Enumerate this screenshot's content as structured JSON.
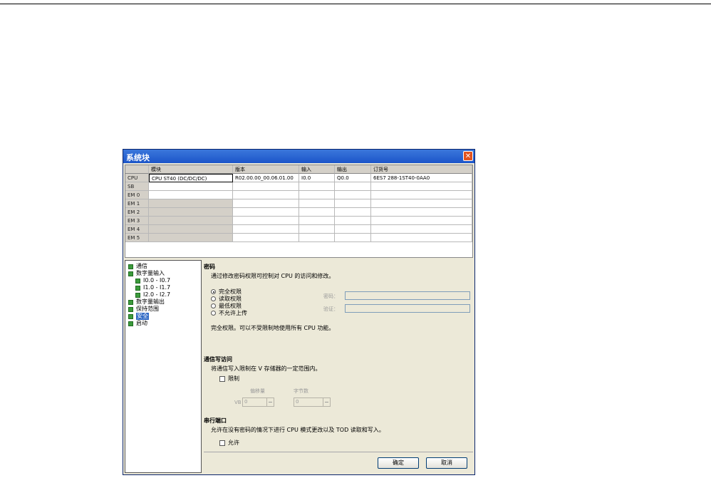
{
  "window": {
    "title": "系统块",
    "close_glyph": "✕"
  },
  "grid": {
    "headers": [
      "",
      "模块",
      "版本",
      "输入",
      "输出",
      "订货号"
    ],
    "rows": [
      {
        "label": "CPU",
        "module": "CPU ST40 (DC/DC/DC)",
        "version": "R02.00.00_00.06.01.00",
        "input": "I0.0",
        "output": "Q0.0",
        "order": "6ES7 288-1ST40-0AA0"
      },
      {
        "label": "SB",
        "module": "",
        "version": "",
        "input": "",
        "output": "",
        "order": ""
      },
      {
        "label": "EM 0",
        "module": "",
        "version": "",
        "input": "",
        "output": "",
        "order": ""
      },
      {
        "label": "EM 1",
        "module": "",
        "version": "",
        "input": "",
        "output": "",
        "order": ""
      },
      {
        "label": "EM 2",
        "module": "",
        "version": "",
        "input": "",
        "output": "",
        "order": ""
      },
      {
        "label": "EM 3",
        "module": "",
        "version": "",
        "input": "",
        "output": "",
        "order": ""
      },
      {
        "label": "EM 4",
        "module": "",
        "version": "",
        "input": "",
        "output": "",
        "order": ""
      },
      {
        "label": "EM 5",
        "module": "",
        "version": "",
        "input": "",
        "output": "",
        "order": ""
      }
    ]
  },
  "tree": {
    "items": [
      {
        "label": "通信",
        "indent": 0,
        "selected": false
      },
      {
        "label": "数字量输入",
        "indent": 0,
        "selected": false
      },
      {
        "label": "I0.0 - I0.7",
        "indent": 1,
        "selected": false
      },
      {
        "label": "I1.0 - I1.7",
        "indent": 1,
        "selected": false
      },
      {
        "label": "I2.0 - I2.7",
        "indent": 1,
        "selected": false
      },
      {
        "label": "数字量输出",
        "indent": 0,
        "selected": false
      },
      {
        "label": "保持范围",
        "indent": 0,
        "selected": false
      },
      {
        "label": "安全",
        "indent": 0,
        "selected": true
      },
      {
        "label": "启动",
        "indent": 0,
        "selected": false
      }
    ]
  },
  "password": {
    "title": "密码",
    "description": "通过修改密码权限可控制对 CPU 的访问和修改。",
    "options": [
      "完全权限",
      "读取权限",
      "最低权限",
      "不允许上传"
    ],
    "selected_index": 0,
    "password_label": "密码：",
    "verify_label": "验证：",
    "password_value": "",
    "verify_value": "",
    "status": "完全权限。可以不受限制地使用所有 CPU 功能。"
  },
  "comm_write": {
    "title": "通信写访问",
    "description": "将通信写入限制在 V 存储器的一定范围内。",
    "restrict_label": "限制",
    "restrict_checked": false,
    "offset_label": "偏移量",
    "bytes_label": "字节数",
    "vb_prefix": "VB",
    "offset_value": "0",
    "bytes_value": "0"
  },
  "serial_port": {
    "title": "串行端口",
    "description": "允许在没有密码的情况下进行 CPU 模式更改以及 TOD 读取和写入。",
    "allow_label": "允许",
    "allow_checked": false
  },
  "buttons": {
    "ok": "确定",
    "cancel": "取消"
  }
}
